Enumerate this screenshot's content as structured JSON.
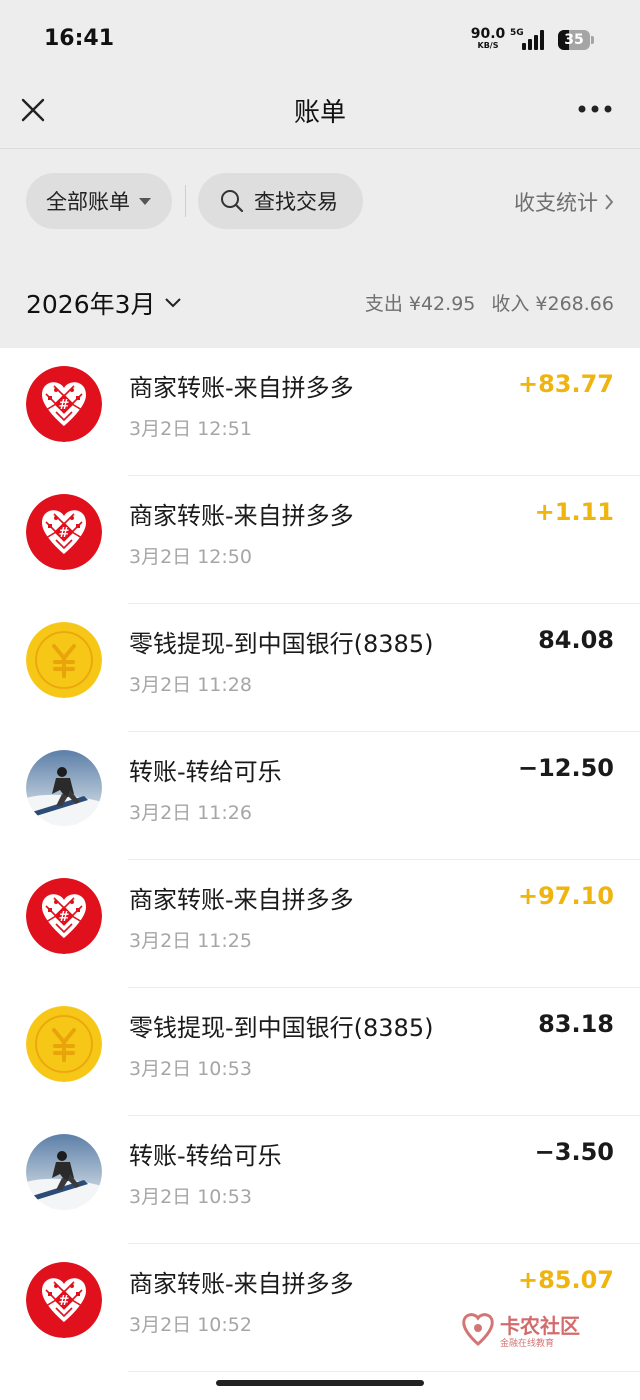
{
  "status_bar": {
    "time": "16:41",
    "net_speed": "90.0",
    "net_unit": "KB/S",
    "network": "5G",
    "battery": "35",
    "battery_level": 0.35
  },
  "nav": {
    "title": "账单",
    "close_icon": "close-icon",
    "more_icon": "more-dots-icon"
  },
  "filters": {
    "all_bills": "全部账单",
    "search": "查找交易",
    "stats": "收支统计"
  },
  "month": {
    "label": "2026年3月",
    "expense": "支出 ¥42.95",
    "income": "收入 ¥268.66"
  },
  "transactions": [
    {
      "title": "商家转账-来自拼多多",
      "time": "3月2日 12:51",
      "amount": "+83.77",
      "kind": "income",
      "icon": "pinduoduo-logo-icon"
    },
    {
      "title": "商家转账-来自拼多多",
      "time": "3月2日 12:50",
      "amount": "+1.11",
      "kind": "income",
      "icon": "pinduoduo-logo-icon"
    },
    {
      "title": "零钱提现-到中国银行(8385)",
      "time": "3月2日 11:28",
      "amount": "84.08",
      "kind": "expense",
      "icon": "yuan-coin-icon"
    },
    {
      "title": "转账-转给可乐",
      "time": "3月2日 11:26",
      "amount": "−12.50",
      "kind": "expense",
      "icon": "user-avatar-photo"
    },
    {
      "title": "商家转账-来自拼多多",
      "time": "3月2日 11:25",
      "amount": "+97.10",
      "kind": "income",
      "icon": "pinduoduo-logo-icon"
    },
    {
      "title": "零钱提现-到中国银行(8385)",
      "time": "3月2日 10:53",
      "amount": "83.18",
      "kind": "expense",
      "icon": "yuan-coin-icon"
    },
    {
      "title": "转账-转给可乐",
      "time": "3月2日 10:53",
      "amount": "−3.50",
      "kind": "expense",
      "icon": "user-avatar-photo"
    },
    {
      "title": "商家转账-来自拼多多",
      "time": "3月2日 10:52",
      "amount": "+85.07",
      "kind": "income",
      "icon": "pinduoduo-logo-icon"
    }
  ],
  "colors": {
    "income": "#f0b40e",
    "pdd_red": "#e0101c",
    "coin_yellow": "#f7c718"
  },
  "watermark": {
    "name": "卡农社区",
    "sub": "金融在线教育"
  }
}
